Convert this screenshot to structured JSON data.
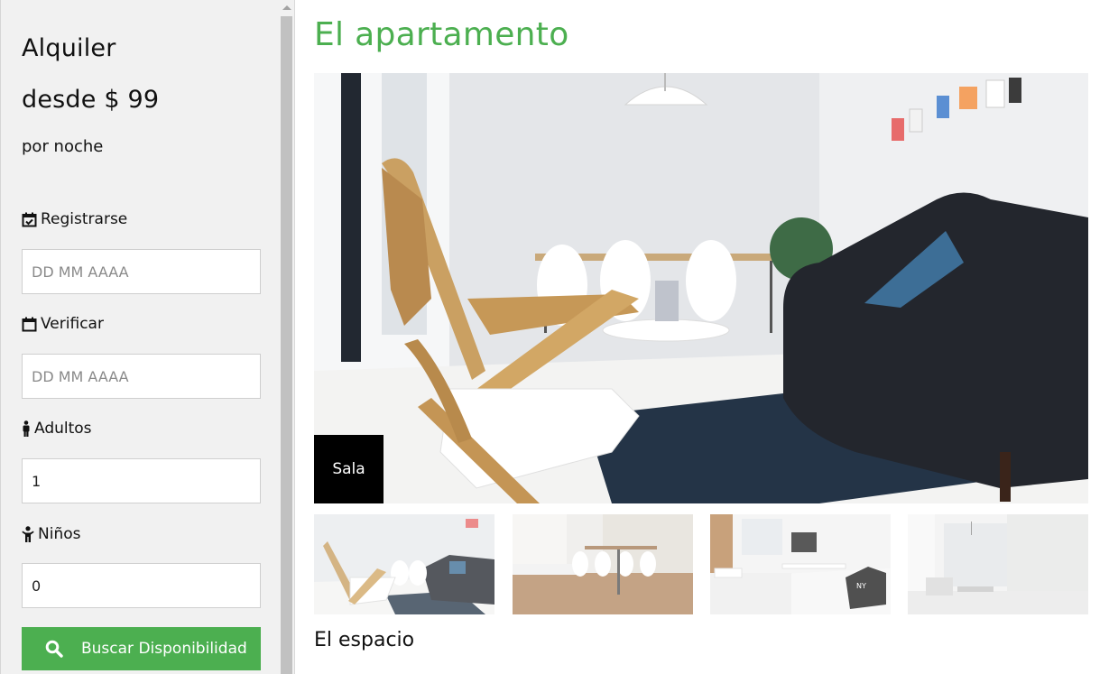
{
  "sidebar": {
    "title": "Alquiler",
    "price": "desde $ 99",
    "per_night": "por noche",
    "checkin": {
      "label": "Registrarse",
      "placeholder": "DD MM AAAA",
      "value": ""
    },
    "checkout": {
      "label": "Verificar",
      "placeholder": "DD MM AAAA",
      "value": ""
    },
    "adults": {
      "label": "Adultos",
      "value": "1"
    },
    "children": {
      "label": "Niños",
      "value": "0"
    },
    "search_button": "Buscar Disponibilidad"
  },
  "main": {
    "title": "El apartamento",
    "hero_caption": "Sala",
    "section_heading": "El espacio"
  },
  "colors": {
    "accent": "#4caf50",
    "caption_bg": "#000000",
    "sidebar_bg": "#f1f1f1"
  }
}
